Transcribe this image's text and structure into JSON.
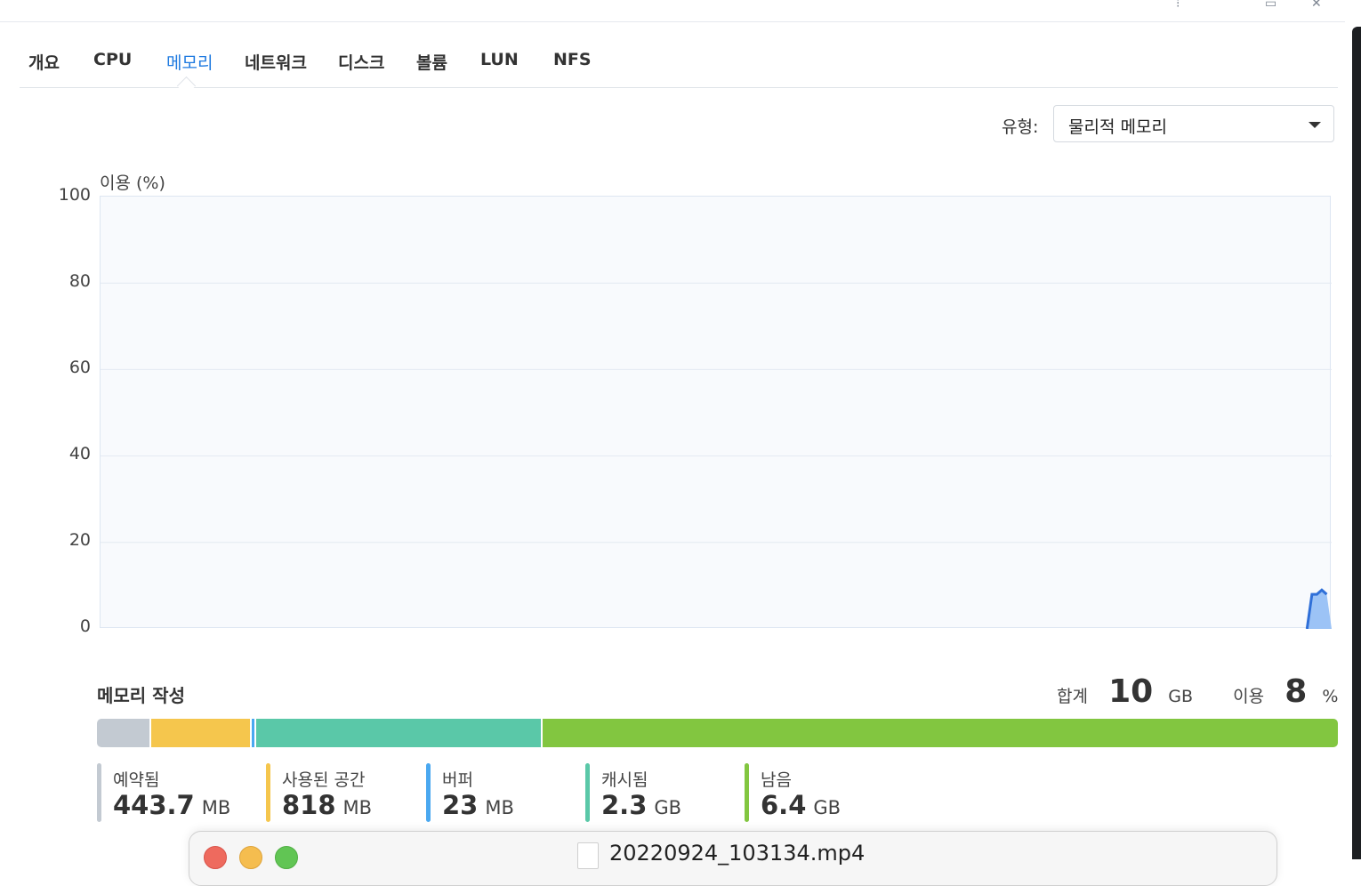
{
  "tabs": [
    {
      "label": "개요",
      "active": false
    },
    {
      "label": "CPU",
      "active": false
    },
    {
      "label": "메모리",
      "active": true
    },
    {
      "label": "네트워크",
      "active": false
    },
    {
      "label": "디스크",
      "active": false
    },
    {
      "label": "볼륨",
      "active": false
    },
    {
      "label": "LUN",
      "active": false
    },
    {
      "label": "NFS",
      "active": false
    }
  ],
  "type_filter": {
    "label": "유형:",
    "selected": "물리적 메모리"
  },
  "chart_data": {
    "type": "area",
    "ylabel": "이용 (%)",
    "ylim": [
      0,
      100
    ],
    "yticks": [
      "100",
      "80",
      "60",
      "40",
      "20",
      "0"
    ],
    "grid": true,
    "x": [
      0,
      1,
      2,
      3,
      4,
      5
    ],
    "values": [
      0,
      8,
      8,
      9,
      8,
      0
    ],
    "x_range": [
      0,
      100
    ],
    "x_start": 98,
    "x_end": 100,
    "line_color": "#2f6fd8",
    "fill_color": "#9cc3f6"
  },
  "composition": {
    "title": "메모리 작성",
    "total_label": "합계",
    "total_value": "10",
    "total_unit": "GB",
    "usage_label": "이용",
    "usage_value": "8",
    "usage_unit": "%",
    "segments": [
      {
        "name": "예약됨",
        "value": "443.7",
        "unit": "MB",
        "share": 4.4,
        "color": "#c3cad2"
      },
      {
        "name": "사용된 공간",
        "value": "818",
        "unit": "MB",
        "share": 8.1,
        "color": "#f5c64d"
      },
      {
        "name": "버퍼",
        "value": "23",
        "unit": "MB",
        "share": 0.3,
        "color": "#4aa8f0"
      },
      {
        "name": "캐시됨",
        "value": "2.3",
        "unit": "GB",
        "share": 23.1,
        "color": "#5ac8a8"
      },
      {
        "name": "남음",
        "value": "6.4",
        "unit": "GB",
        "share": 64.1,
        "color": "#82c640"
      }
    ]
  },
  "finder": {
    "file_name": "20220924_103134.mp4"
  },
  "icons": [
    "help-icon",
    "maximize-icon",
    "close-icon",
    "dropdown-arrow-icon",
    "file-icon"
  ]
}
